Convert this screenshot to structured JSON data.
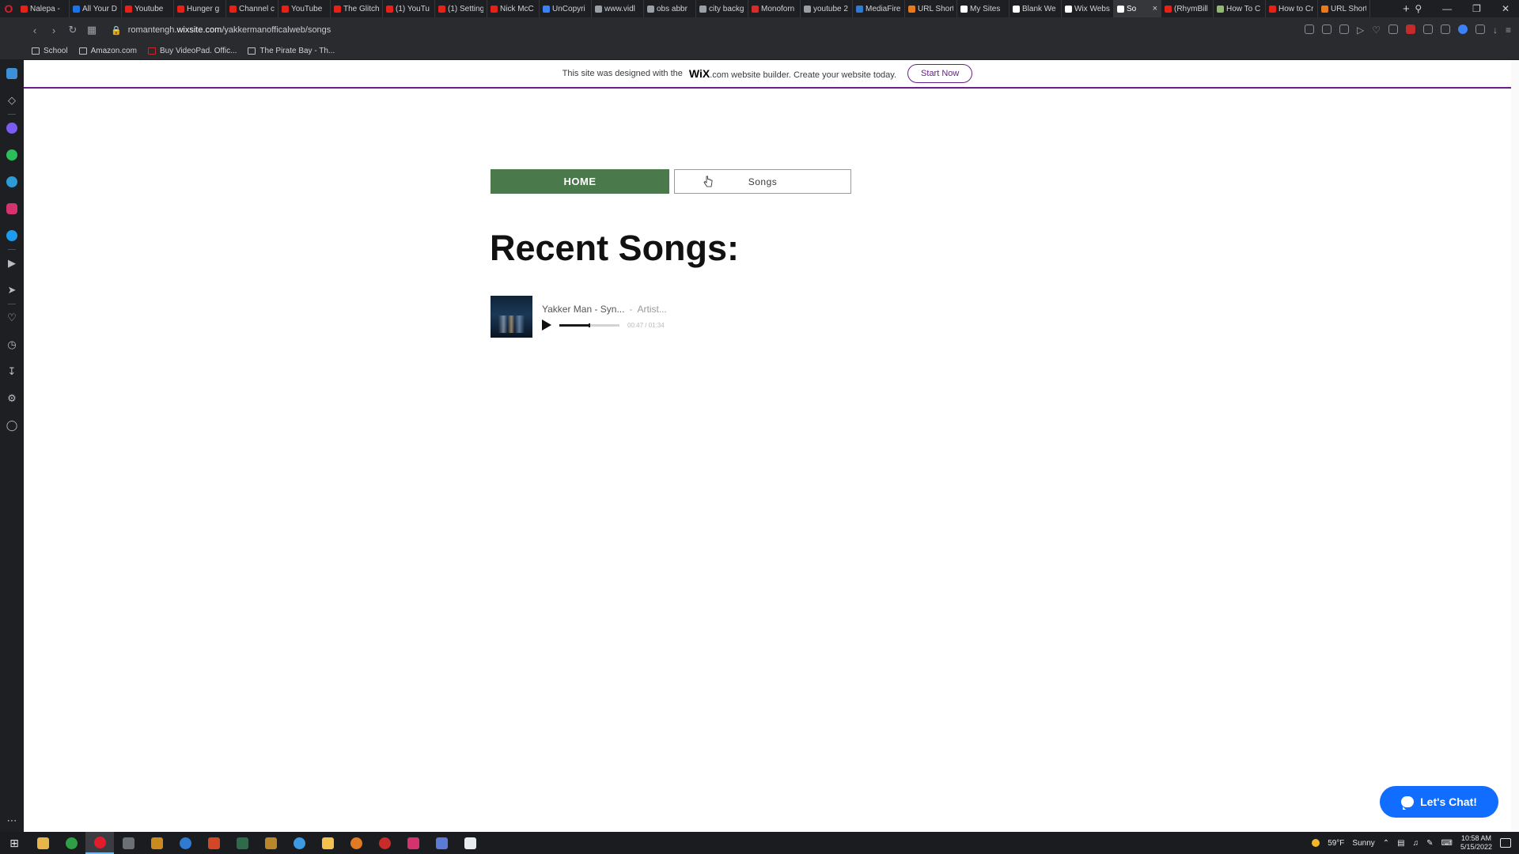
{
  "browser": {
    "tabs": [
      {
        "title": "Nalepa - ",
        "favicon": "youtube-icon",
        "color": "#e62117"
      },
      {
        "title": "All Your D",
        "favicon": "xc-icon",
        "color": "#1a73e8"
      },
      {
        "title": "Youtube",
        "favicon": "youtube-icon",
        "color": "#e62117"
      },
      {
        "title": "Hunger g",
        "favicon": "youtube-icon",
        "color": "#e62117"
      },
      {
        "title": "Channel c",
        "favicon": "youtube-icon",
        "color": "#e62117"
      },
      {
        "title": "YouTube",
        "favicon": "youtube-icon",
        "color": "#e62117"
      },
      {
        "title": "The Glitch",
        "favicon": "youtube-icon",
        "color": "#e62117"
      },
      {
        "title": "(1) YouTu",
        "favicon": "youtube-icon",
        "color": "#e62117"
      },
      {
        "title": "(1) Setting",
        "favicon": "youtube-icon",
        "color": "#e62117"
      },
      {
        "title": "Nick McC",
        "favicon": "youtube-icon",
        "color": "#e62117"
      },
      {
        "title": "UnCopyri",
        "favicon": "uncopyright-icon",
        "color": "#3b82f6"
      },
      {
        "title": "www.vidl",
        "favicon": "globe-icon",
        "color": "#9aa0a6"
      },
      {
        "title": "obs abbr",
        "favicon": "google-icon",
        "color": "#9aa0a6"
      },
      {
        "title": "city backg",
        "favicon": "google-icon",
        "color": "#9aa0a6"
      },
      {
        "title": "Monoforn",
        "favicon": "monoform-icon",
        "color": "#d62c2c"
      },
      {
        "title": "youtube 2",
        "favicon": "google-icon",
        "color": "#9aa0a6"
      },
      {
        "title": "MediaFire",
        "favicon": "mediafire-icon",
        "color": "#2f7bd1"
      },
      {
        "title": "URL Short",
        "favicon": "url-icon",
        "color": "#e87a1e"
      },
      {
        "title": "My Sites",
        "favicon": "wix-icon",
        "color": "#ffffff"
      },
      {
        "title": "Blank We",
        "favicon": "wix-icon",
        "color": "#ffffff"
      },
      {
        "title": "Wix Webs",
        "favicon": "wix-icon",
        "color": "#ffffff"
      },
      {
        "title": "So",
        "favicon": "wix-icon",
        "color": "#ffffff",
        "active": true
      },
      {
        "title": "(RhymBill",
        "favicon": "youtube-icon",
        "color": "#e62117"
      },
      {
        "title": "How To C",
        "favicon": "wikihow-icon",
        "color": "#93b874"
      },
      {
        "title": "How to Cr",
        "favicon": "youtube-icon",
        "color": "#e62117"
      },
      {
        "title": "URL Short",
        "favicon": "url-icon",
        "color": "#e87a1e"
      }
    ],
    "url_prefix": "romantengh.",
    "url_domain": "wixsite.com",
    "url_path": "/yakkermanofficalweb/songs",
    "bookmarks": [
      "School",
      "Amazon.com",
      "Buy VideoPad. Offic...",
      "The Pirate Bay - Th..."
    ]
  },
  "banner": {
    "text_before": "This site was designed with the",
    "wix_logo": "WiX",
    "text_after": ".com website builder. Create your website today.",
    "cta": "Start Now"
  },
  "menu": {
    "home": "HOME",
    "songs": "Songs"
  },
  "page": {
    "heading": "Recent Songs:"
  },
  "player": {
    "track": "Yakker Man - Syn...",
    "separator": "-",
    "artist": "Artist...",
    "current_time": "00:47",
    "duration": "01:34",
    "progress_fraction": 0.5,
    "elapsed_display": "00:47 / 01:34"
  },
  "chat": {
    "label": "Let's Chat!"
  },
  "taskbar": {
    "weather_temp": "59°F",
    "weather_desc": "Sunny",
    "time": "10:58 AM",
    "date": "5/15/2022"
  },
  "colors": {
    "home_button": "#4a7a4c",
    "wix_purple": "#6b1f8a",
    "chat_blue": "#116dff",
    "opera_red": "#e11d2c"
  }
}
